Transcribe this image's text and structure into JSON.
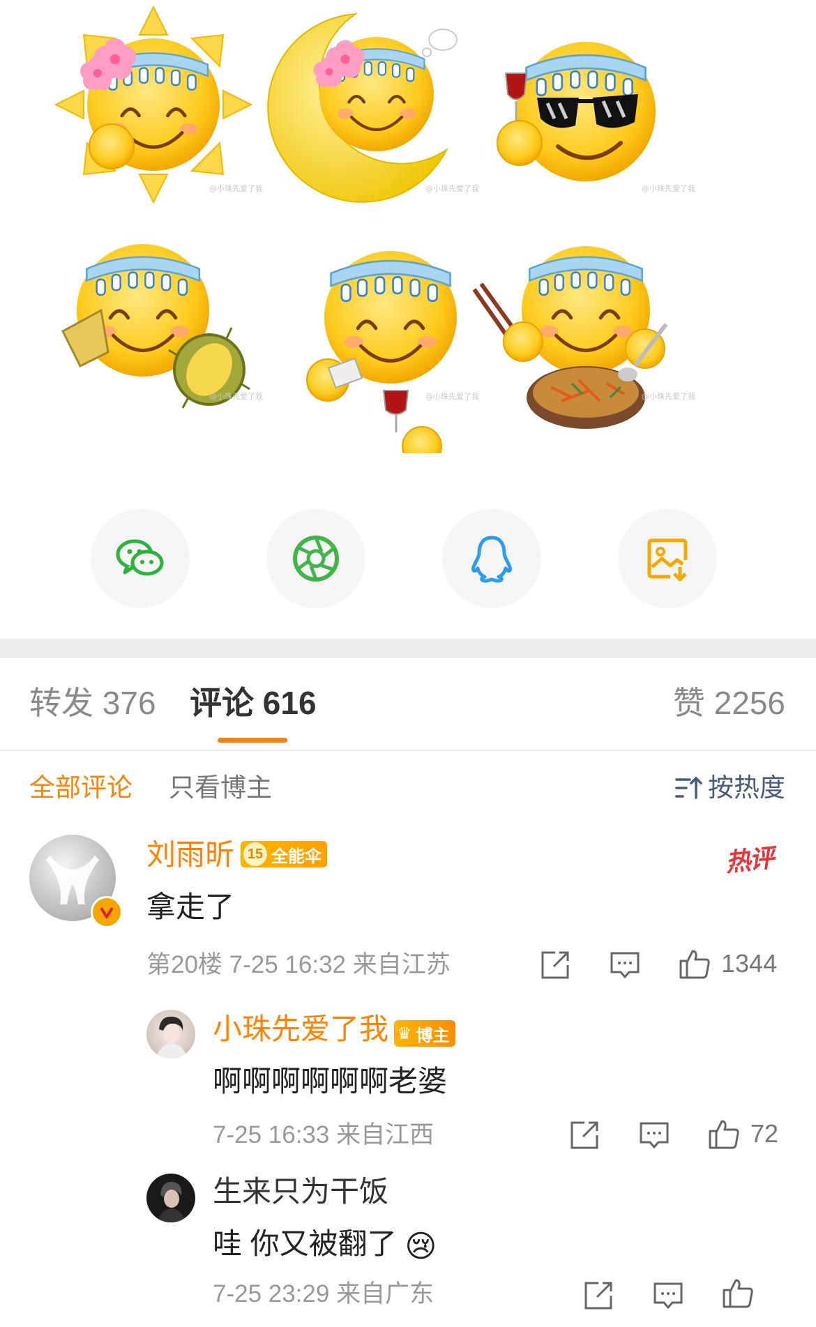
{
  "stickers": [
    {
      "name": "sun-smiley-sticker",
      "watermark": "@小珠先爱了我"
    },
    {
      "name": "moon-smiley-sticker",
      "watermark": "@小珠先爱了我"
    },
    {
      "name": "sunglasses-smiley-sticker",
      "watermark": "@小珠先爱了我"
    },
    {
      "name": "durian-smiley-sticker",
      "watermark": "@小珠先爱了我"
    },
    {
      "name": "wine-smiley-sticker",
      "watermark": "@小珠先爱了我"
    },
    {
      "name": "noodles-smiley-sticker",
      "watermark": "@小珠先爱了我"
    }
  ],
  "share": [
    {
      "icon": "wechat-icon",
      "color": "#2ab33d"
    },
    {
      "icon": "moments-icon",
      "color": "#41b547"
    },
    {
      "icon": "qq-icon",
      "color": "#2d9cf0"
    },
    {
      "icon": "save-image-icon",
      "color": "#f7a800"
    }
  ],
  "tabs": {
    "repost_label": "转发",
    "repost_count": "376",
    "comment_label": "评论",
    "comment_count": "616",
    "like_label": "赞",
    "like_count": "2256"
  },
  "filters": {
    "all": "全部评论",
    "author_only": "只看博主",
    "sort": "按热度"
  },
  "comments": [
    {
      "user": "刘雨昕",
      "badge_level": "15",
      "badge_text": "全能伞",
      "hot_label": "热评",
      "text": "拿走了",
      "meta": "第20楼 7-25 16:32 来自江苏",
      "likes": "1344"
    }
  ],
  "replies": [
    {
      "user": "小珠先爱了我",
      "badge_text": "博主",
      "text": "啊啊啊啊啊啊老婆",
      "meta": "7-25 16:33 来自江西",
      "likes": "72"
    },
    {
      "user": "生来只为干饭",
      "text": "哇 你又被翻了",
      "emoji": "😢",
      "meta": "7-25 23:29 来自广东"
    }
  ],
  "colors": {
    "accent": "#ff8200",
    "hot": "#e8343a"
  }
}
